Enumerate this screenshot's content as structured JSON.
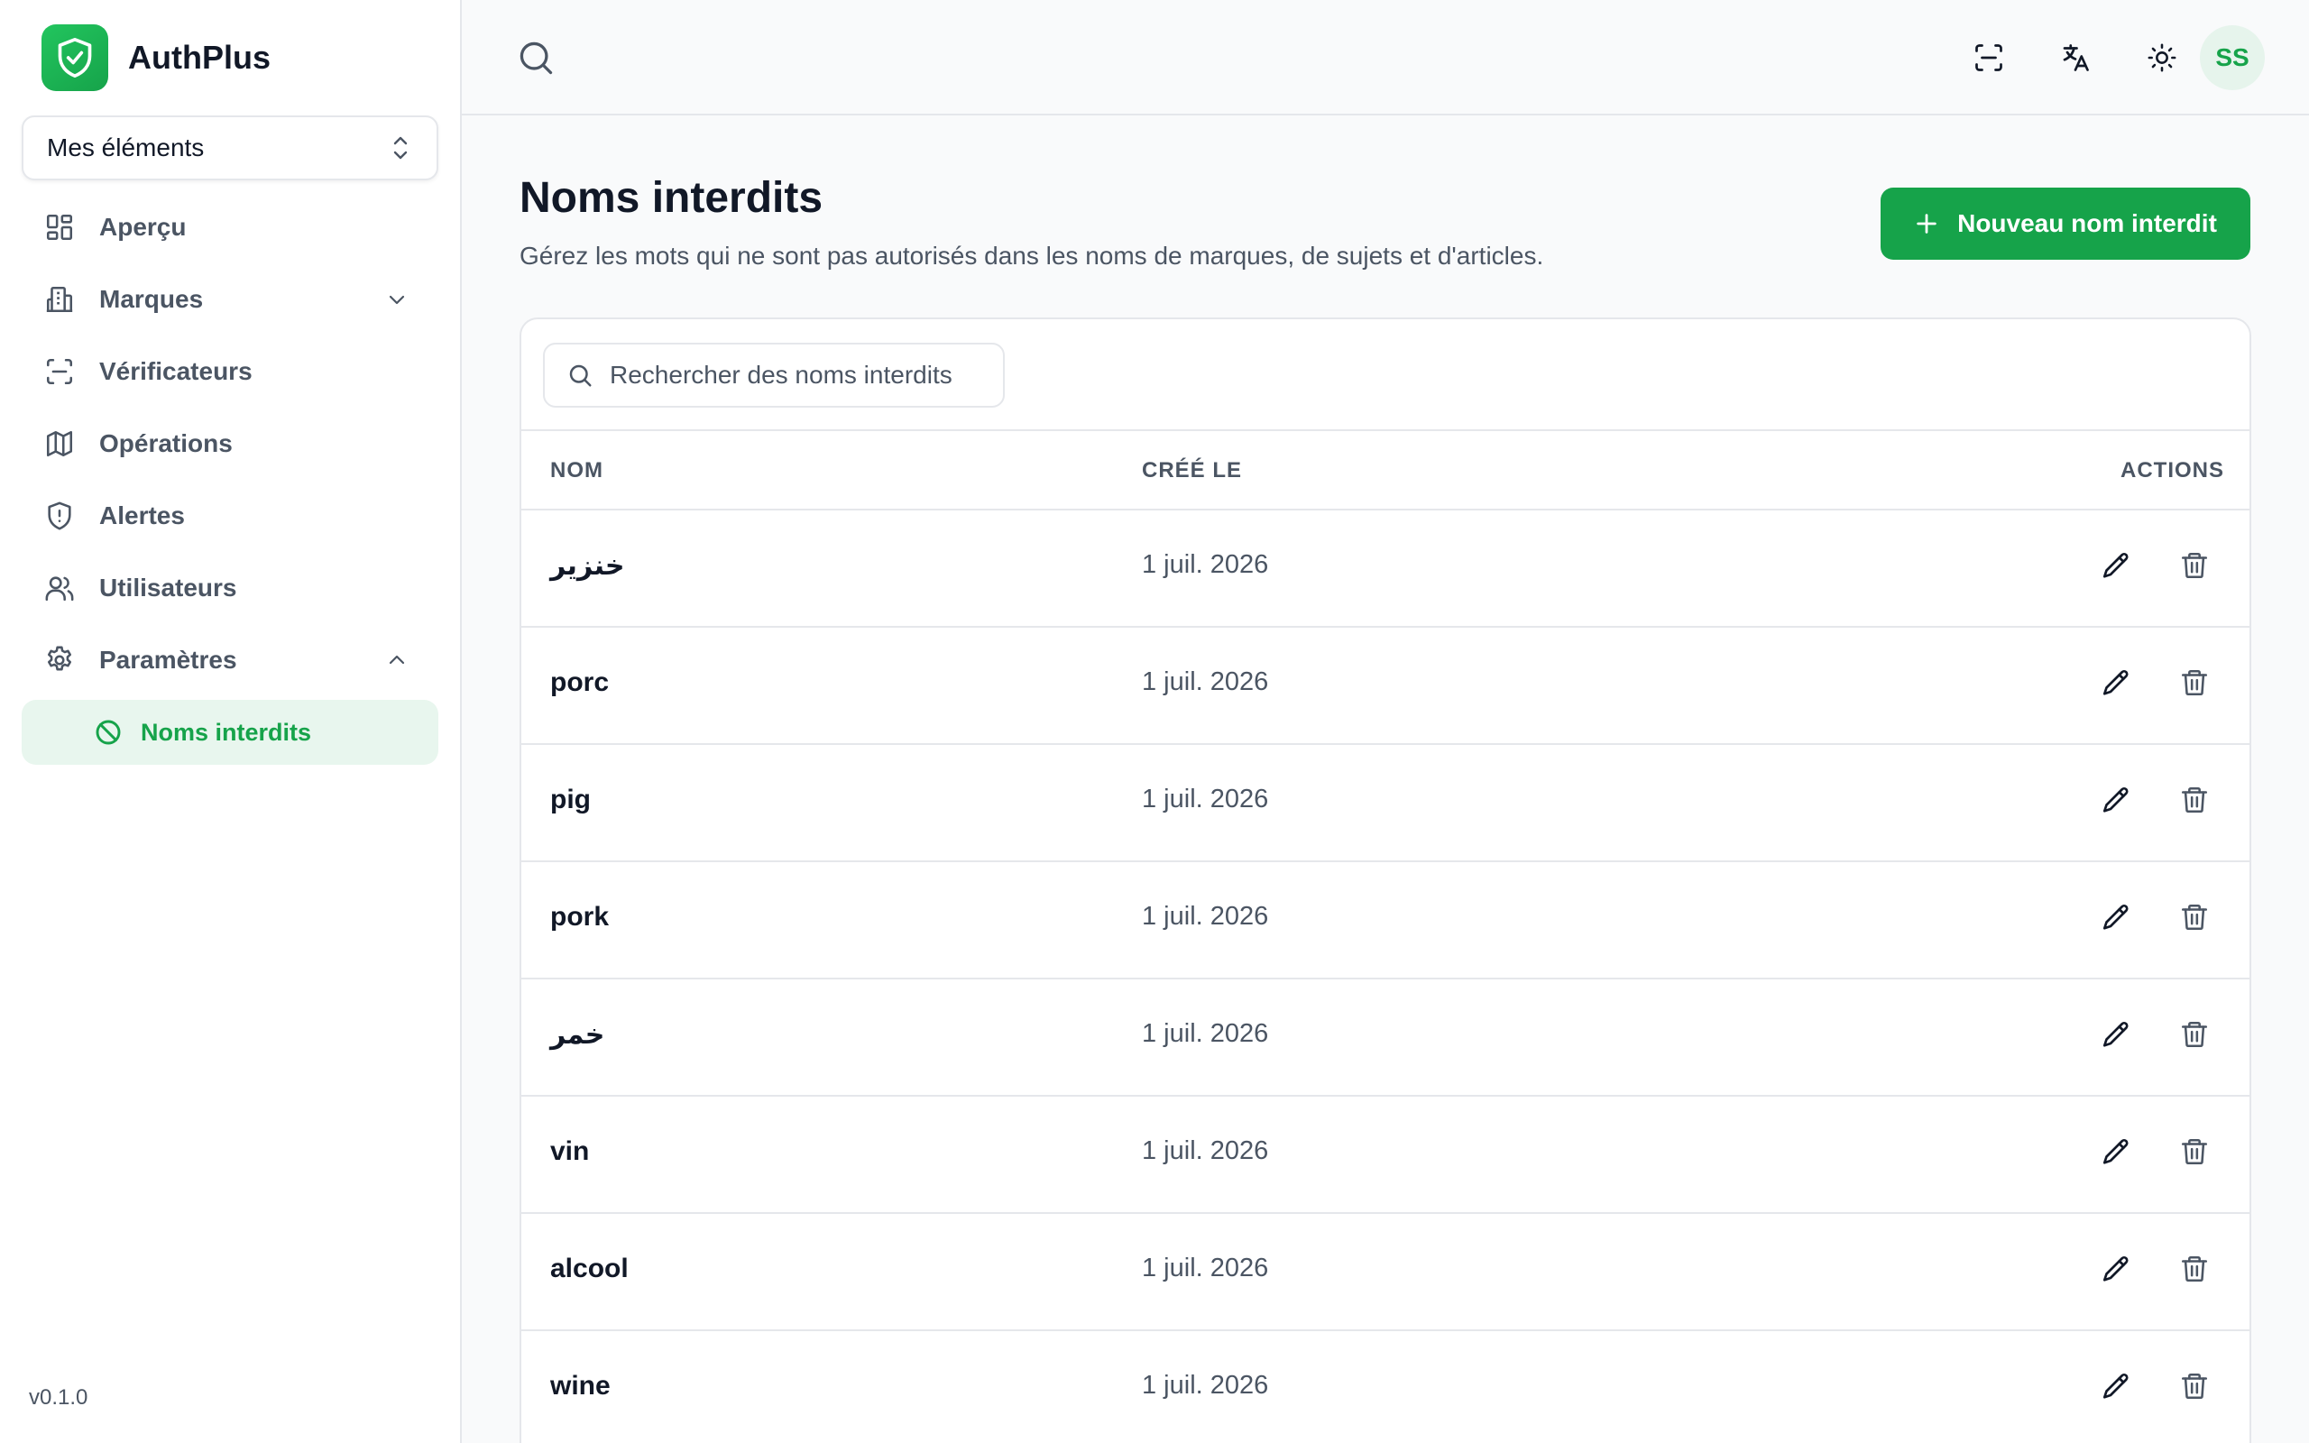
{
  "app": {
    "name": "AuthPlus",
    "version": "v0.1.0"
  },
  "sidebar": {
    "selector_label": "Mes éléments",
    "items": [
      {
        "label": "Aperçu",
        "icon": "grid-icon"
      },
      {
        "label": "Marques",
        "icon": "building-icon"
      },
      {
        "label": "Vérificateurs",
        "icon": "scan-icon"
      },
      {
        "label": "Opérations",
        "icon": "map-icon"
      },
      {
        "label": "Alertes",
        "icon": "shield-alert-icon"
      },
      {
        "label": "Utilisateurs",
        "icon": "users-icon"
      },
      {
        "label": "Paramètres",
        "icon": "gear-icon"
      }
    ],
    "active_subitem": {
      "label": "Noms interdits",
      "icon": "ban-icon"
    }
  },
  "header": {
    "avatar_initials": "SS"
  },
  "page": {
    "title": "Noms interdits",
    "subtitle": "Gérez les mots qui ne sont pas autorisés dans les noms de marques, de sujets et d'articles.",
    "new_button_label": "Nouveau nom interdit",
    "search_placeholder": "Rechercher des noms interdits"
  },
  "table": {
    "columns": [
      "NOM",
      "CRÉÉ LE",
      "ACTIONS"
    ],
    "rows": [
      {
        "name": "خنزير",
        "created": "1 juil. 2026"
      },
      {
        "name": "porc",
        "created": "1 juil. 2026"
      },
      {
        "name": "pig",
        "created": "1 juil. 2026"
      },
      {
        "name": "pork",
        "created": "1 juil. 2026"
      },
      {
        "name": "خمر",
        "created": "1 juil. 2026"
      },
      {
        "name": "vin",
        "created": "1 juil. 2026"
      },
      {
        "name": "alcool",
        "created": "1 juil. 2026"
      },
      {
        "name": "wine",
        "created": "1 juil. 2026"
      }
    ]
  },
  "colors": {
    "accent": "#16a34a",
    "accent_light": "#e8f6ee",
    "text": "#111827",
    "muted": "#4b5563",
    "border": "#e5e7eb"
  }
}
